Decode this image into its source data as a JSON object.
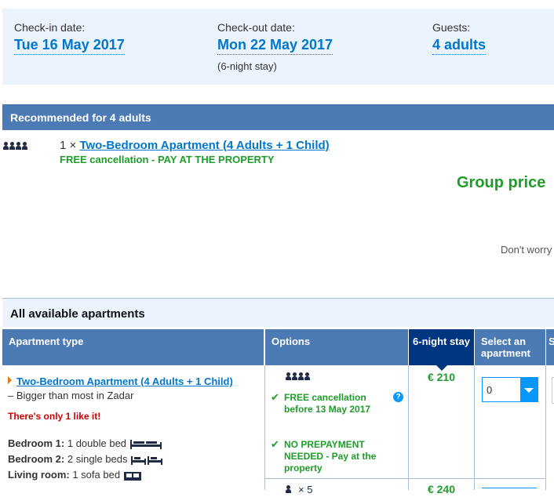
{
  "dates": {
    "checkin_label": "Check-in date:",
    "checkin_value": "Tue 16 May 2017",
    "checkout_label": "Check-out date:",
    "checkout_value": "Mon 22 May 2017",
    "stay_note": "(6-night stay)",
    "guests_label": "Guests:",
    "guests_value": "4 adults"
  },
  "recommended": {
    "heading": "Recommended for 4 adults",
    "quantity": "1 ×",
    "apartment_link": "Two-Bedroom Apartment (4 Adults + 1 Child)",
    "policy": "FREE cancellation - PAY AT THE PROPERTY",
    "group_price": "Group price",
    "dont_worry": "Don't worry"
  },
  "all_apartments": {
    "heading": "All available apartments",
    "columns": [
      "Apartment type",
      "Options",
      "6-night stay",
      "Select an apartment",
      "S"
    ]
  },
  "row1": {
    "apartment_link": "Two-Bedroom Apartment (4 Adults + 1 Child)",
    "bigger": "– Bigger than most in Zadar",
    "scarcity": "There's only 1 like it!",
    "bedroom1_label": "Bedroom 1:",
    "bedroom1_value": "1 double bed",
    "bedroom2_label": "Bedroom 2:",
    "bedroom2_value": "2 single beds",
    "living_label": "Living room:",
    "living_value": "1 sofa bed",
    "option1": "FREE cancellation before 13 May 2017",
    "option2": "NO PREPAYMENT NEEDED - Pay at the property",
    "price": "€ 210",
    "select_value": "0"
  },
  "row2": {
    "guests": "× 5",
    "price": "€ 240"
  },
  "colors": {
    "accent": "#0077cc",
    "header_blue": "#4c7ab5",
    "light_blue": "#ebf3ff",
    "green": "#1f9d2a",
    "navy": "#003580",
    "scarcity_red": "#cc0000"
  }
}
